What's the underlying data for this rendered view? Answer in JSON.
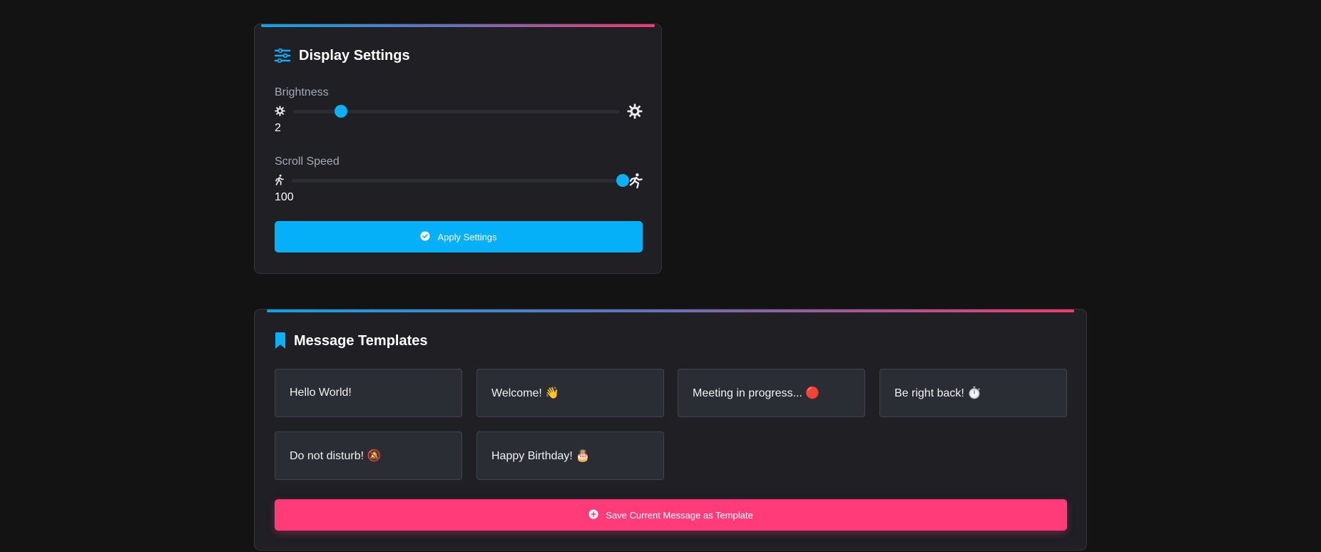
{
  "display_settings": {
    "title": "Display Settings",
    "brightness": {
      "label": "Brightness",
      "value": "2",
      "level_fraction": 0.146,
      "min_icon": "sun-small-icon",
      "max_icon": "sun-large-icon"
    },
    "scroll_speed": {
      "label": "Scroll Speed",
      "value": "100",
      "level_fraction": 1.0,
      "min_icon": "walking-icon",
      "max_icon": "running-icon"
    },
    "apply_button": {
      "label": "Apply Settings",
      "icon": "check-circle-icon"
    }
  },
  "message_templates": {
    "title": "Message Templates",
    "icon": "bookmark-icon",
    "items": [
      {
        "label": "Hello World!"
      },
      {
        "label": "Welcome! 👋"
      },
      {
        "label": "Meeting in progress... 🔴"
      },
      {
        "label": "Be right back! ⏱️"
      },
      {
        "label": "Do not disturb! 🔕"
      },
      {
        "label": "Happy Birthday! 🎂"
      }
    ],
    "save_button": {
      "label": "Save Current Message as Template",
      "icon": "plus-circle-icon"
    }
  },
  "colors": {
    "background": "#131314",
    "card": "#1f1f24",
    "accent_blue": "#06b0f8",
    "accent_pink": "#ff3b79",
    "gradient": [
      "#0fa3e6",
      "#f23a6e"
    ]
  }
}
